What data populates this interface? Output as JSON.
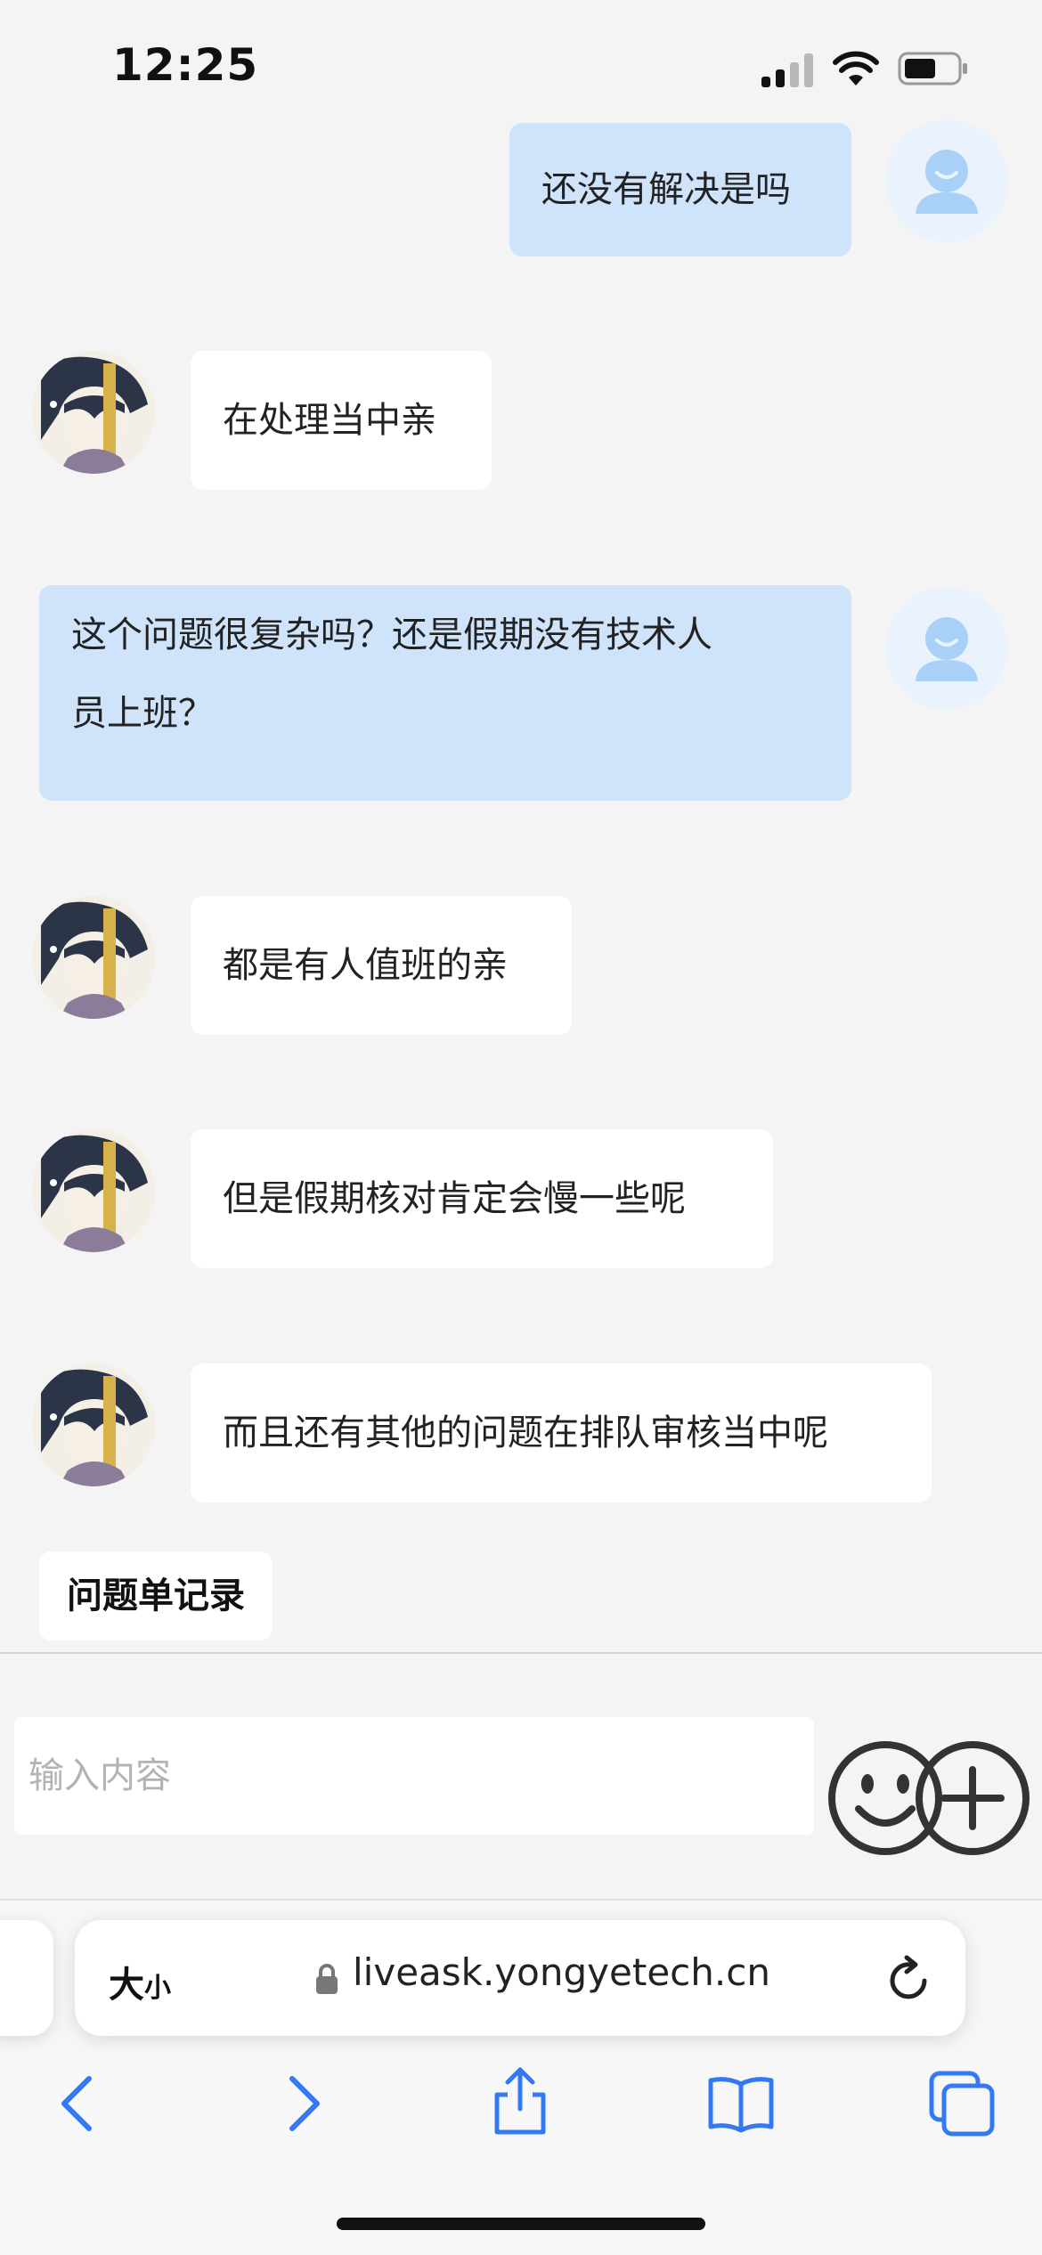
{
  "status_bar": {
    "time": "12:25"
  },
  "chat": {
    "messages": [
      {
        "from": "user",
        "text": "还没有解决是吗"
      },
      {
        "from": "agent",
        "text": "在处理当中亲"
      },
      {
        "from": "user",
        "lines": [
          "这个问题很复杂吗？还是假期没有技术人",
          "员上班？"
        ]
      },
      {
        "from": "agent",
        "text": "都是有人值班的亲"
      },
      {
        "from": "agent",
        "text": "但是假期核对肯定会慢一些呢"
      },
      {
        "from": "agent",
        "text": "而且还有其他的问题在排队审核当中呢"
      }
    ]
  },
  "record_button": {
    "label": "问题单记录"
  },
  "composer": {
    "placeholder": "输入内容",
    "value": ""
  },
  "browser": {
    "text_size_big": "大",
    "text_size_small": "小",
    "url": "liveask.yongyetech.cn"
  },
  "colors": {
    "accent": "#3478f6",
    "user_bubble": "#cfe3fa",
    "agent_bubble": "#ffffff",
    "background": "#f4f4f4"
  },
  "icons": {
    "composer": [
      "emoji-icon",
      "plus-circle-icon"
    ],
    "toolbar": [
      "back-icon",
      "forward-icon",
      "share-icon",
      "bookmarks-icon",
      "tabs-icon"
    ]
  }
}
